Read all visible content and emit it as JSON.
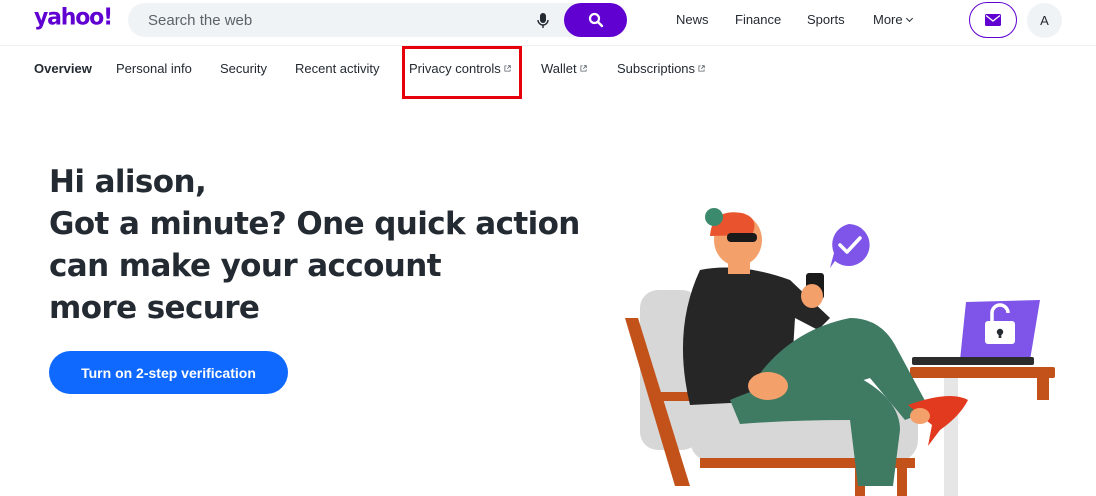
{
  "header": {
    "logo": "yahoo!",
    "search_placeholder": "Search the web",
    "nav": [
      "News",
      "Finance",
      "Sports",
      "More"
    ],
    "avatar_initial": "A"
  },
  "subnav": {
    "items": [
      {
        "label": "Overview",
        "active": true,
        "external": false
      },
      {
        "label": "Personal info",
        "active": false,
        "external": false
      },
      {
        "label": "Security",
        "active": false,
        "external": false
      },
      {
        "label": "Recent activity",
        "active": false,
        "external": false
      },
      {
        "label": "Privacy controls",
        "active": false,
        "external": true
      },
      {
        "label": "Wallet",
        "active": false,
        "external": true
      },
      {
        "label": "Subscriptions",
        "active": false,
        "external": true
      }
    ]
  },
  "hero": {
    "lines": [
      "Hi alison,",
      "Got a minute? One quick action",
      "can make your account",
      "more secure"
    ],
    "cta_label": "Turn on 2-step verification"
  },
  "colors": {
    "brand": "#6001d2",
    "cta": "#0f69ff",
    "highlight": "#e5000b"
  }
}
